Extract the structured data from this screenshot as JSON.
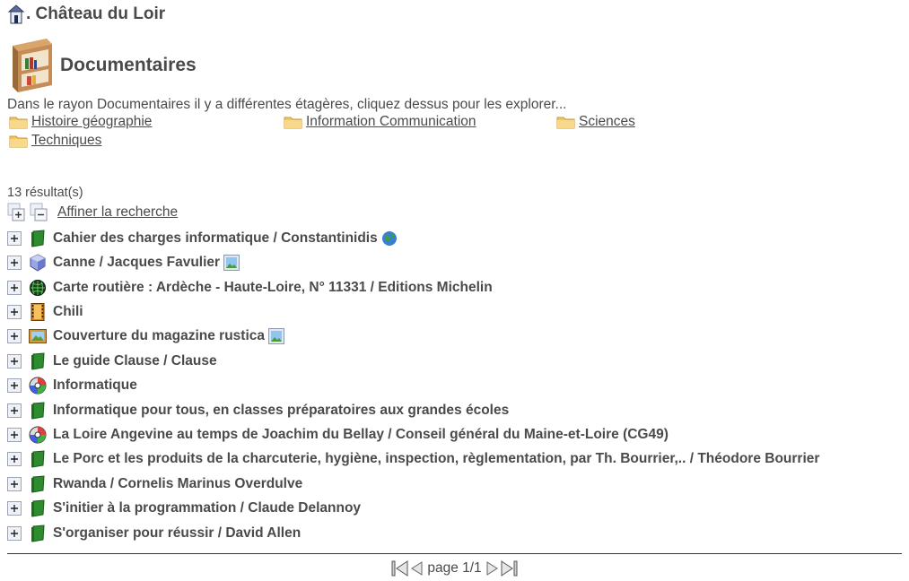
{
  "library": {
    "title": ". Château du Loir",
    "icon": "library-house-icon"
  },
  "shelf": {
    "title": "Documentaires",
    "icon": "bookshelf-icon",
    "intro": "Dans le rayon Documentaires il y a différentes étagères, cliquez dessus pour les explorer..."
  },
  "subshelves": [
    {
      "label": "Histoire géographie",
      "icon": "folder-icon"
    },
    {
      "label": "Information Communication",
      "icon": "folder-icon"
    },
    {
      "label": "Sciences",
      "icon": "folder-icon"
    },
    {
      "label": "Techniques",
      "icon": "folder-icon"
    }
  ],
  "results": {
    "count_label": "13 résultat(s)",
    "refine_label": "Affiner la recherche",
    "items": [
      {
        "label": "Cahier des charges informatique / Constantinidis",
        "type_icon": "book-icon",
        "extra_icon": "globe-icon"
      },
      {
        "label": "Canne / Jacques Favulier",
        "type_icon": "3d-object-icon",
        "extra_icon": "image-icon"
      },
      {
        "label": "Carte routière : Ardèche - Haute-Loire, N° 11331 / Editions Michelin",
        "type_icon": "map-globe-icon",
        "extra_icon": ""
      },
      {
        "label": "Chili",
        "type_icon": "film-icon",
        "extra_icon": ""
      },
      {
        "label": "Couverture du magazine rustica",
        "type_icon": "picture-icon",
        "extra_icon": "image-icon"
      },
      {
        "label": "Le guide Clause / Clause",
        "type_icon": "book-icon",
        "extra_icon": ""
      },
      {
        "label": "Informatique",
        "type_icon": "cd-icon",
        "extra_icon": ""
      },
      {
        "label": "Informatique pour tous, en classes préparatoires aux grandes écoles",
        "type_icon": "book-icon",
        "extra_icon": ""
      },
      {
        "label": "La Loire Angevine au temps de Joachim du Bellay / Conseil général du Maine-et-Loire (CG49)",
        "type_icon": "cd-icon",
        "extra_icon": ""
      },
      {
        "label": "Le Porc et les produits de la charcuterie, hygiène, inspection, règlementation, par Th. Bourrier,.. / Théodore Bourrier",
        "type_icon": "book-icon",
        "extra_icon": ""
      },
      {
        "label": "Rwanda / Cornelis Marinus Overdulve",
        "type_icon": "book-icon",
        "extra_icon": ""
      },
      {
        "label": "S'initier à la programmation / Claude Delannoy",
        "type_icon": "book-icon",
        "extra_icon": ""
      },
      {
        "label": "S'organiser pour réussir / David Allen",
        "type_icon": "book-icon",
        "extra_icon": ""
      }
    ]
  },
  "pager": {
    "label": "page 1/1"
  },
  "colors": {
    "text": "#4a4a4a",
    "book_green": "#2e8b2e",
    "folder_yellow": "#f3c460"
  }
}
